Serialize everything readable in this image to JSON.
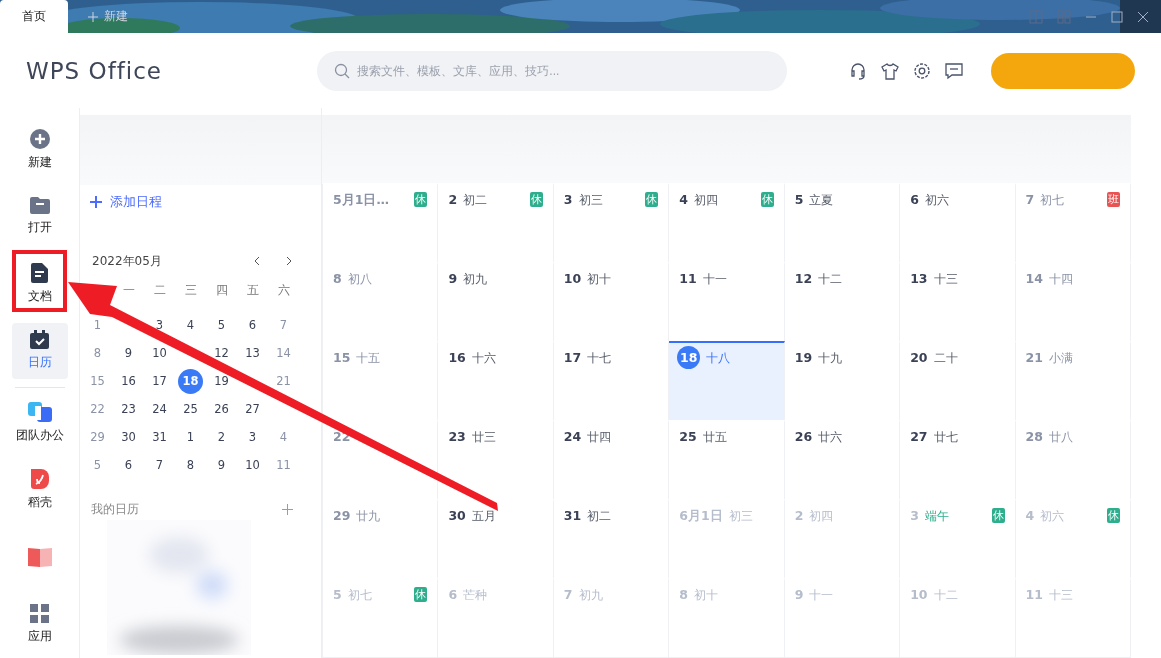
{
  "titlebar": {
    "tabs": [
      {
        "label": "首页",
        "selected": true
      },
      {
        "label": "新建",
        "selected": false
      }
    ]
  },
  "header": {
    "logo": "WPS Office",
    "search": {
      "placeholder": "搜索文件、模板、文库、应用、技巧..."
    }
  },
  "nav": [
    {
      "label": "新建",
      "kind": "plus",
      "selected": false
    },
    {
      "label": "打开",
      "kind": "folder",
      "selected": false
    },
    {
      "label": "文档",
      "kind": "doc",
      "selected": false
    },
    {
      "label": "日历",
      "kind": "calendar",
      "selected": true
    },
    {
      "label": "团队办公",
      "kind": "team",
      "selected": false
    },
    {
      "label": "稻壳",
      "kind": "daoke",
      "selected": false
    },
    {
      "kind": "book",
      "selected": false
    },
    {
      "label": "应用",
      "kind": "apps",
      "selected": false
    }
  ],
  "agenda": {
    "add": "添加日程",
    "month": "2022年05月",
    "weekdays": [
      "一",
      "二",
      "三",
      "四",
      "五",
      "六"
    ],
    "days": [
      {
        "d": "1",
        "selected": false
      },
      {
        "d": "3",
        "selected": false
      },
      {
        "d": "4",
        "selected": false
      },
      {
        "d": "5",
        "selected": false
      },
      {
        "d": "6",
        "selected": false
      },
      {
        "d": "7",
        "selected": false
      },
      {
        "d": "8",
        "selected": false
      },
      {
        "d": "9",
        "selected": false
      },
      {
        "d": "10",
        "selected": false
      },
      {
        "d": "12",
        "selected": false
      },
      {
        "d": "13",
        "selected": false
      },
      {
        "d": "14",
        "selected": false
      },
      {
        "d": "15",
        "selected": false
      },
      {
        "d": "16",
        "selected": false
      },
      {
        "d": "17",
        "selected": false
      },
      {
        "d": "18",
        "selected": true
      },
      {
        "d": "19",
        "selected": false
      },
      {
        "d": "21",
        "selected": false
      },
      {
        "d": "22",
        "selected": false
      },
      {
        "d": "23",
        "selected": false
      },
      {
        "d": "24",
        "selected": false
      },
      {
        "d": "25",
        "selected": false
      },
      {
        "d": "26",
        "selected": false
      },
      {
        "d": "27",
        "selected": false
      },
      {
        "d": "29",
        "selected": false
      },
      {
        "d": "30",
        "selected": false
      },
      {
        "d": "31",
        "selected": false
      },
      {
        "d": "1",
        "selected": false
      },
      {
        "d": "2",
        "selected": false
      },
      {
        "d": "3",
        "selected": false
      },
      {
        "d": "4",
        "selected": false
      },
      {
        "d": "5",
        "selected": false
      },
      {
        "d": "6",
        "selected": false
      },
      {
        "d": "7",
        "selected": false
      },
      {
        "d": "8",
        "selected": false
      },
      {
        "d": "9",
        "selected": false
      },
      {
        "d": "10",
        "selected": false
      },
      {
        "d": "11",
        "selected": false
      }
    ],
    "my_calendars": "我的日历"
  },
  "calendar": {
    "weeks": [
      [
        {
          "day": "5月1日…",
          "kind": "weekend",
          "selected": false,
          "badge": "休",
          "color": "#2fae8e"
        },
        {
          "day": "2",
          "lunar": "初二",
          "kind": "weekday",
          "selected": false,
          "festival": false,
          "badge": "休",
          "color": "#2fae8e"
        },
        {
          "day": "3",
          "lunar": "初三",
          "kind": "weekday",
          "selected": false,
          "festival": false,
          "badge": "休",
          "color": "#2fae8e"
        },
        {
          "day": "4",
          "lunar": "初四",
          "kind": "weekday",
          "selected": false,
          "festival": false,
          "badge": "休",
          "color": "#2fae8e"
        },
        {
          "day": "5",
          "lunar": "立夏",
          "kind": "weekday",
          "selected": false,
          "festival": false
        },
        {
          "day": "6",
          "lunar": "初六",
          "kind": "weekday",
          "selected": false,
          "festival": false
        },
        {
          "day": "7",
          "lunar": "初七",
          "kind": "weekend",
          "selected": false,
          "festival": false,
          "badge": "班",
          "color": "#e85454"
        }
      ],
      [
        {
          "day": "8",
          "lunar": "初八",
          "kind": "weekend",
          "selected": false,
          "festival": false
        },
        {
          "day": "9",
          "lunar": "初九",
          "kind": "weekday",
          "selected": false,
          "festival": false
        },
        {
          "day": "10",
          "lunar": "初十",
          "kind": "weekday",
          "selected": false,
          "festival": false
        },
        {
          "day": "11",
          "lunar": "十一",
          "kind": "weekday",
          "selected": false,
          "festival": false
        },
        {
          "day": "12",
          "lunar": "十二",
          "kind": "weekday",
          "selected": false,
          "festival": false
        },
        {
          "day": "13",
          "lunar": "十三",
          "kind": "weekday",
          "selected": false,
          "festival": false
        },
        {
          "day": "14",
          "lunar": "十四",
          "kind": "weekend",
          "selected": false,
          "festival": false
        }
      ],
      [
        {
          "day": "15",
          "lunar": "十五",
          "kind": "weekend",
          "selected": false,
          "festival": false
        },
        {
          "day": "16",
          "lunar": "十六",
          "kind": "weekday",
          "selected": false,
          "festival": false
        },
        {
          "day": "17",
          "lunar": "十七",
          "kind": "weekday",
          "selected": false,
          "festival": false
        },
        {
          "day": "18",
          "lunar": "十八",
          "kind": "weekday",
          "selected": true,
          "festival": false
        },
        {
          "day": "19",
          "lunar": "十九",
          "kind": "weekday",
          "selected": false,
          "festival": false
        },
        {
          "day": "20",
          "lunar": "二十",
          "kind": "weekday",
          "selected": false,
          "festival": false
        },
        {
          "day": "21",
          "lunar": "小满",
          "kind": "weekend",
          "selected": false,
          "festival": false
        }
      ],
      [
        {
          "day": "22",
          "kind": "weekend",
          "selected": false
        },
        {
          "day": "23",
          "lunar": "廿三",
          "kind": "weekday",
          "selected": false,
          "festival": false
        },
        {
          "day": "24",
          "lunar": "廿四",
          "kind": "weekday",
          "selected": false,
          "festival": false
        },
        {
          "day": "25",
          "lunar": "廿五",
          "kind": "weekday",
          "selected": false,
          "festival": false
        },
        {
          "day": "26",
          "lunar": "廿六",
          "kind": "weekday",
          "selected": false,
          "festival": false
        },
        {
          "day": "27",
          "lunar": "廿七",
          "kind": "weekday",
          "selected": false,
          "festival": false
        },
        {
          "day": "28",
          "lunar": "廿八",
          "kind": "weekend",
          "selected": false,
          "festival": false
        }
      ],
      [
        {
          "day": "29",
          "lunar": "廿九",
          "kind": "weekend",
          "selected": false,
          "festival": false
        },
        {
          "day": "30",
          "lunar": "五月",
          "kind": "weekday",
          "selected": false,
          "festival": false
        },
        {
          "day": "31",
          "lunar": "初二",
          "kind": "weekday",
          "selected": false,
          "festival": false
        },
        {
          "day": "6月1日",
          "lunar": "初三",
          "kind": "other",
          "selected": false,
          "festival": false
        },
        {
          "day": "2",
          "lunar": "初四",
          "kind": "other",
          "selected": false,
          "festival": false
        },
        {
          "day": "3",
          "lunar": "端午",
          "kind": "other",
          "selected": false,
          "festival": true,
          "badge": "休",
          "color": "#2fae8e"
        },
        {
          "day": "4",
          "lunar": "初六",
          "kind": "other",
          "selected": false,
          "festival": false,
          "badge": "休",
          "color": "#2fae8e"
        }
      ],
      [
        {
          "day": "5",
          "lunar": "初七",
          "kind": "other",
          "selected": false,
          "festival": false,
          "badge": "休",
          "color": "#2fae8e"
        },
        {
          "day": "6",
          "lunar": "芒种",
          "kind": "other",
          "selected": false,
          "festival": false
        },
        {
          "day": "7",
          "lunar": "初九",
          "kind": "other",
          "selected": false,
          "festival": false
        },
        {
          "day": "8",
          "lunar": "初十",
          "kind": "other",
          "selected": false,
          "festival": false
        },
        {
          "day": "9",
          "lunar": "十一",
          "kind": "other",
          "selected": false,
          "festival": false
        },
        {
          "day": "10",
          "lunar": "十二",
          "kind": "other",
          "selected": false,
          "festival": false
        },
        {
          "day": "11",
          "lunar": "十三",
          "kind": "other",
          "selected": false,
          "festival": false
        }
      ]
    ]
  }
}
